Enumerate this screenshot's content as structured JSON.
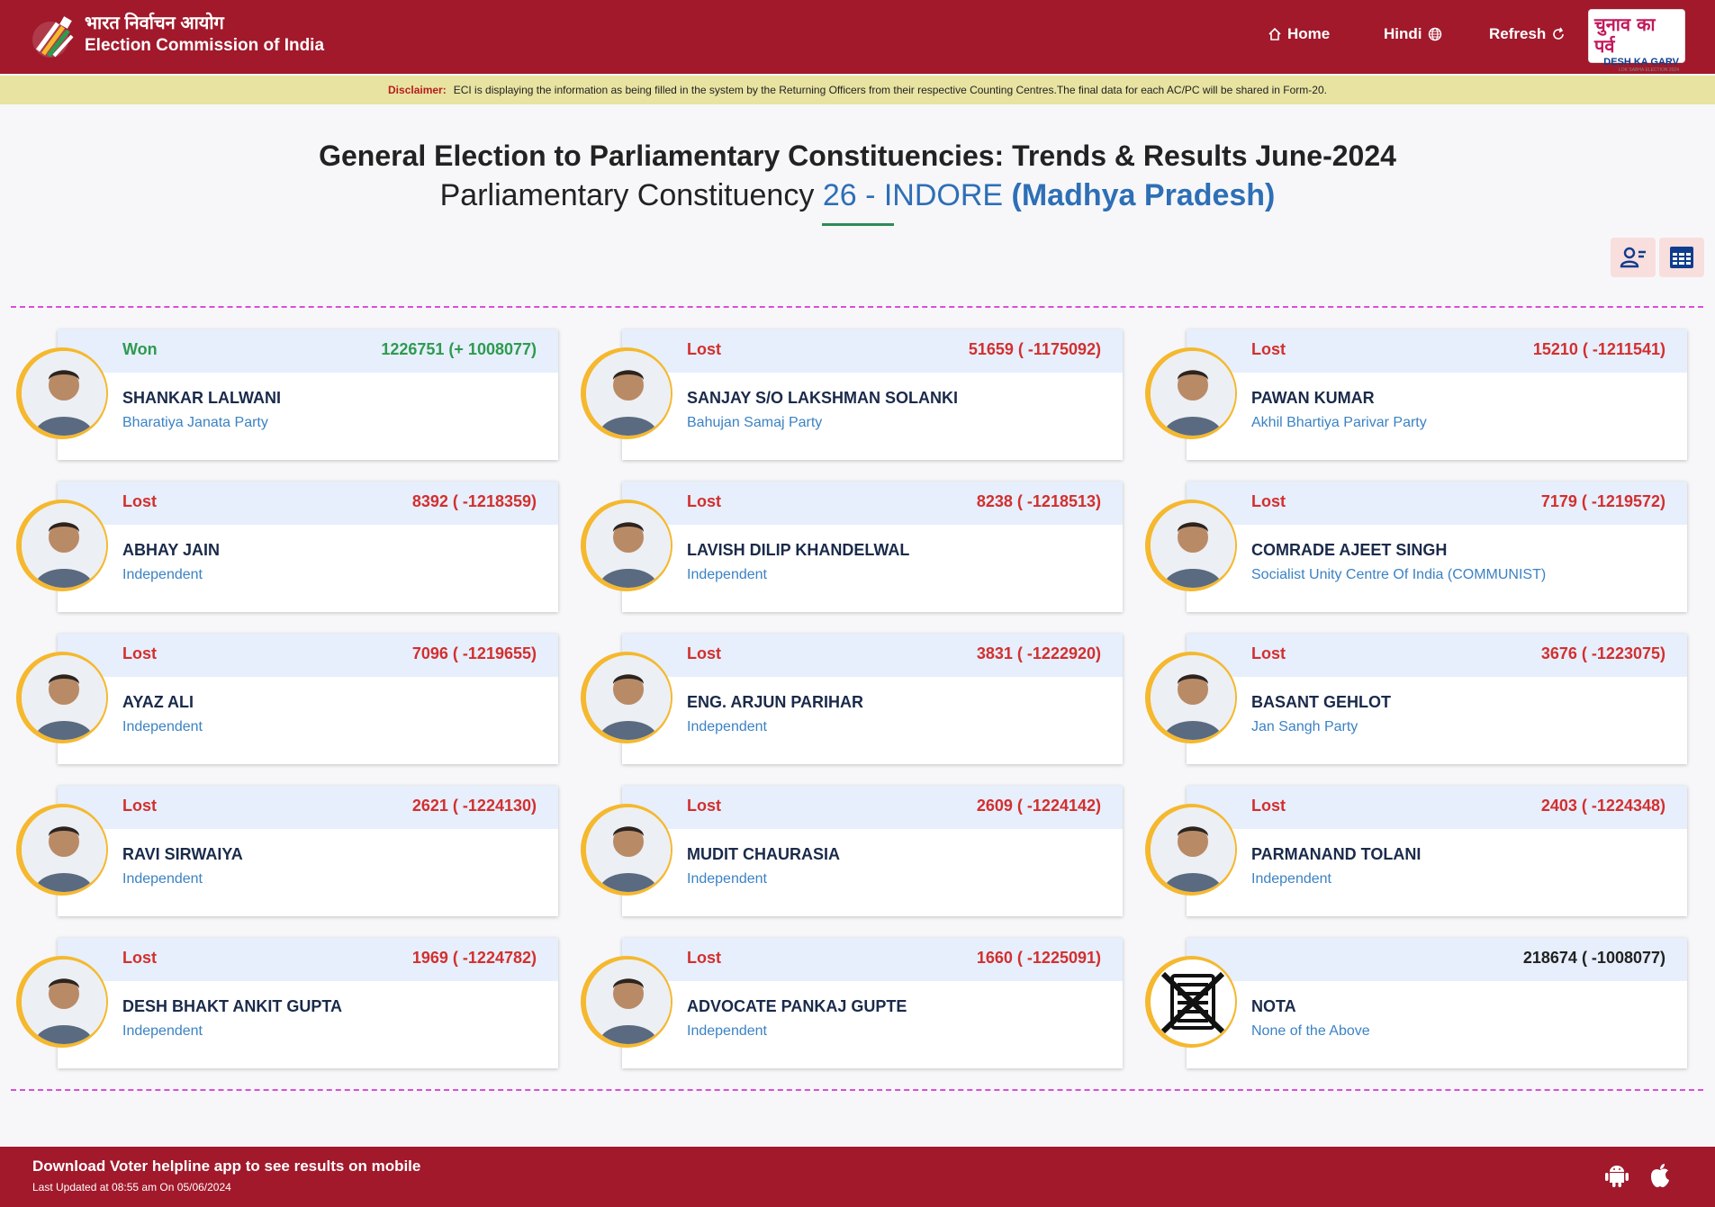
{
  "header": {
    "org_hindi": "भारत निर्वाचन आयोग",
    "org_english": "Election Commission of India",
    "nav": {
      "home": "Home",
      "hindi": "Hindi",
      "refresh": "Refresh"
    },
    "badge": {
      "line1": "चुनाव का पर्व",
      "line2": "DESH KA GARV",
      "line3": "LOK SABHA ELECTION 2024"
    }
  },
  "disclaimer": {
    "label": "Disclaimer:",
    "text": "ECI is displaying the information as being filled in the system by the Returning Officers from their respective Counting Centres.The final data for each AC/PC will be shared in Form-20."
  },
  "title": {
    "line1": "General Election to Parliamentary Constituencies: Trends & Results June-2024",
    "line2_prefix": "Parliamentary Constituency",
    "constituency": "26 - INDORE",
    "state": "(Madhya Pradesh)"
  },
  "icons": {
    "home": "home-icon",
    "hindi": "globe-icon",
    "refresh": "refresh-icon",
    "candidate_view": "user-list-icon",
    "table_view": "table-icon",
    "android": "android-icon",
    "apple": "apple-icon"
  },
  "colors": {
    "brand": "#a1192b",
    "won": "#2e9a50",
    "lost": "#d32f2f",
    "ring": "#f5b82e",
    "link": "#3b82c4"
  },
  "candidates": [
    {
      "status": "Won",
      "votes": "1226751 (+ 1008077)",
      "name": "SHANKAR LALWANI",
      "party": "Bharatiya Janata Party"
    },
    {
      "status": "Lost",
      "votes": "51659 ( -1175092)",
      "name": "SANJAY S/O LAKSHMAN SOLANKI",
      "party": "Bahujan Samaj Party"
    },
    {
      "status": "Lost",
      "votes": "15210 ( -1211541)",
      "name": "PAWAN KUMAR",
      "party": "Akhil Bhartiya Parivar Party"
    },
    {
      "status": "Lost",
      "votes": "8392 ( -1218359)",
      "name": "ABHAY JAIN",
      "party": "Independent"
    },
    {
      "status": "Lost",
      "votes": "8238 ( -1218513)",
      "name": "LAVISH DILIP KHANDELWAL",
      "party": "Independent"
    },
    {
      "status": "Lost",
      "votes": "7179 ( -1219572)",
      "name": "COMRADE AJEET SINGH",
      "party": "Socialist Unity Centre Of India (COMMUNIST)"
    },
    {
      "status": "Lost",
      "votes": "7096 ( -1219655)",
      "name": "AYAZ ALI",
      "party": "Independent"
    },
    {
      "status": "Lost",
      "votes": "3831 ( -1222920)",
      "name": "ENG. ARJUN PARIHAR",
      "party": "Independent"
    },
    {
      "status": "Lost",
      "votes": "3676 ( -1223075)",
      "name": "BASANT GEHLOT",
      "party": "Jan Sangh Party"
    },
    {
      "status": "Lost",
      "votes": "2621 ( -1224130)",
      "name": "RAVI SIRWAIYA",
      "party": "Independent"
    },
    {
      "status": "Lost",
      "votes": "2609 ( -1224142)",
      "name": "MUDIT CHAURASIA",
      "party": "Independent"
    },
    {
      "status": "Lost",
      "votes": "2403 ( -1224348)",
      "name": "PARMANAND TOLANI",
      "party": "Independent"
    },
    {
      "status": "Lost",
      "votes": "1969 ( -1224782)",
      "name": "DESH BHAKT ANKIT GUPTA",
      "party": "Independent"
    },
    {
      "status": "Lost",
      "votes": "1660 ( -1225091)",
      "name": "ADVOCATE PANKAJ GUPTE",
      "party": "Independent"
    },
    {
      "status": "",
      "votes": "218674 ( -1008077)",
      "name": "NOTA",
      "party": "None of the Above"
    }
  ],
  "footer": {
    "line1": "Download Voter helpline app to see results on mobile",
    "line2": "Last Updated at 08:55 am On 05/06/2024"
  }
}
